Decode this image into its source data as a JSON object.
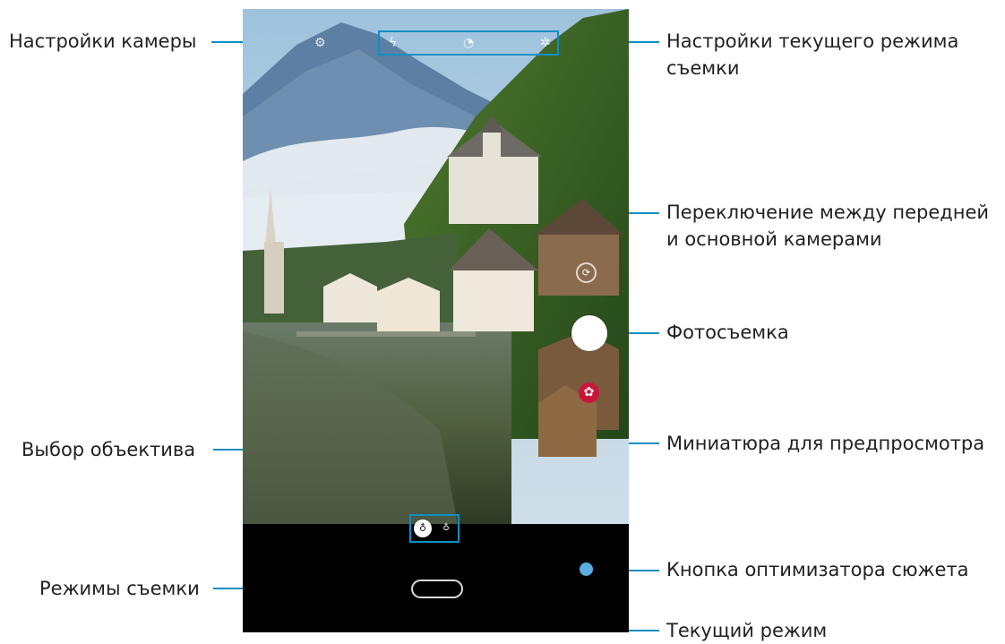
{
  "labels": {
    "camera_settings": "Настройки камеры",
    "current_mode_settings_line1": "Настройки текущего режима",
    "current_mode_settings_line2": "съемки",
    "switch_camera_line1": "Переключение между передней",
    "switch_camera_line2": "и основной камерами",
    "take_photo": "Фотосъемка",
    "preview_thumbnail": "Миниатюра для предпросмотра",
    "lens_selection": "Выбор объектива",
    "scene_optimizer_button": "Кнопка оптимизатора сюжета",
    "shooting_modes": "Режимы съемки",
    "current_mode": "Текущий режим"
  },
  "camera_ui": {
    "settings_icon": "gear-icon",
    "top_icons": [
      "flash-icon",
      "timer-icon",
      "filter-icon"
    ],
    "switch_icon": "camera-switch-icon",
    "thumbnail_icon": "flower-icon",
    "lens_buttons": [
      "wide-lens-icon",
      "ultra-wide-lens-icon"
    ],
    "modes": [
      "",
      "",
      "",
      ""
    ],
    "current_mode": ""
  },
  "colors": {
    "leader_line": "#0f8fc4",
    "thumbnail": "#c8163a",
    "scene_optimizer": "#5aaee0"
  }
}
